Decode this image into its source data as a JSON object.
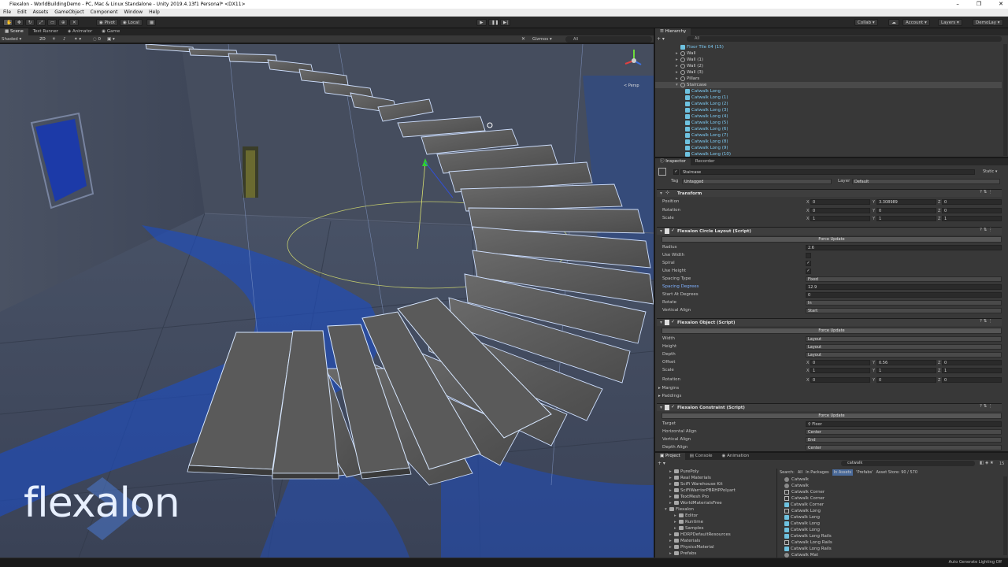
{
  "window": {
    "title": "Flexalon - WorldBuildingDemo - PC, Mac & Linux Standalone - Unity 2019.4.13f1 Personal* <DX11>",
    "controls": [
      "–",
      "❐",
      "✕"
    ]
  },
  "menu": [
    "File",
    "Edit",
    "Assets",
    "GameObject",
    "Component",
    "Window",
    "Help"
  ],
  "toolbar": {
    "pivot": "Pivot",
    "local": "Local",
    "collab": "Collab ▾",
    "account": "Account ▾",
    "layers": "Layers ▾",
    "layout": "DemoLay ▾"
  },
  "scene": {
    "tabs": [
      "Scene",
      "Test Runner",
      "Animator",
      "Game"
    ],
    "shading": "Shaded",
    "gizmos": "Gizmos ▾",
    "search": "All",
    "persp": "< Persp",
    "watermark": "flexalon"
  },
  "hierarchy": {
    "tab": "Hierarchy",
    "search": "All",
    "items": [
      {
        "label": "Floor Tile 04 (15)",
        "indent": 1,
        "kind": "prefab",
        "arrow": ""
      },
      {
        "label": "Wall",
        "indent": 1,
        "kind": "go",
        "arrow": "▸"
      },
      {
        "label": "Wall (1)",
        "indent": 1,
        "kind": "go",
        "arrow": "▸"
      },
      {
        "label": "Wall (2)",
        "indent": 1,
        "kind": "go",
        "arrow": "▸"
      },
      {
        "label": "Wall (3)",
        "indent": 1,
        "kind": "go",
        "arrow": "▸"
      },
      {
        "label": "Pillars",
        "indent": 1,
        "kind": "go",
        "arrow": "▸"
      },
      {
        "label": "Staircase",
        "indent": 1,
        "kind": "go-selected",
        "arrow": "▾"
      },
      {
        "label": "Catwalk Long",
        "indent": 2,
        "kind": "prefab",
        "arrow": ""
      },
      {
        "label": "Catwalk Long (1)",
        "indent": 2,
        "kind": "prefab",
        "arrow": ""
      },
      {
        "label": "Catwalk Long (2)",
        "indent": 2,
        "kind": "prefab",
        "arrow": ""
      },
      {
        "label": "Catwalk Long (3)",
        "indent": 2,
        "kind": "prefab",
        "arrow": ""
      },
      {
        "label": "Catwalk Long (4)",
        "indent": 2,
        "kind": "prefab",
        "arrow": ""
      },
      {
        "label": "Catwalk Long (5)",
        "indent": 2,
        "kind": "prefab",
        "arrow": ""
      },
      {
        "label": "Catwalk Long (6)",
        "indent": 2,
        "kind": "prefab",
        "arrow": ""
      },
      {
        "label": "Catwalk Long (7)",
        "indent": 2,
        "kind": "prefab",
        "arrow": ""
      },
      {
        "label": "Catwalk Long (8)",
        "indent": 2,
        "kind": "prefab",
        "arrow": ""
      },
      {
        "label": "Catwalk Long (9)",
        "indent": 2,
        "kind": "prefab",
        "arrow": ""
      },
      {
        "label": "Catwalk Long (10)",
        "indent": 2,
        "kind": "prefab",
        "arrow": ""
      }
    ]
  },
  "inspector": {
    "tabs": [
      "Inspector",
      "Recorder"
    ],
    "object_name": "Staircase",
    "static": "Static ▾",
    "tag_label": "Tag",
    "tag_value": "Untagged",
    "layer_label": "Layer",
    "layer_value": "Default",
    "transform": {
      "title": "Transform",
      "position": {
        "label": "Position",
        "x": "0",
        "y": "3.308989",
        "z": "0"
      },
      "rotation": {
        "label": "Rotation",
        "x": "0",
        "y": "0",
        "z": "0"
      },
      "scale": {
        "label": "Scale",
        "x": "1",
        "y": "1",
        "z": "1"
      }
    },
    "circle_layout": {
      "title": "Flexalon Circle Layout (Script)",
      "button": "Force Update",
      "radius": {
        "label": "Radius",
        "value": "2.6"
      },
      "use_width": {
        "label": "Use Width",
        "value": ""
      },
      "spiral": {
        "label": "Spiral",
        "value": "✓"
      },
      "use_height": {
        "label": "Use Height",
        "value": "✓"
      },
      "spacing_type": {
        "label": "Spacing Type",
        "value": "Fixed"
      },
      "spacing_degrees": {
        "label": "Spacing Degrees",
        "value": "12.9"
      },
      "start_at_degrees": {
        "label": "Start At Degrees",
        "value": "0"
      },
      "rotate": {
        "label": "Rotate",
        "value": "In"
      },
      "vertical_align": {
        "label": "Vertical Align",
        "value": "Start"
      }
    },
    "object": {
      "title": "Flexalon Object (Script)",
      "button": "Force Update",
      "width": {
        "label": "Width",
        "value": "Layout"
      },
      "height": {
        "label": "Height",
        "value": "Layout"
      },
      "depth": {
        "label": "Depth",
        "value": "Layout"
      },
      "offset": {
        "label": "Offset",
        "x": "0",
        "y": "0.56",
        "z": "0"
      },
      "scale": {
        "label": "Scale",
        "x": "1",
        "y": "1",
        "z": "1"
      },
      "rotation": {
        "label": "Rotation",
        "x": "0",
        "y": "0",
        "z": "0"
      },
      "margins": "Margins",
      "paddings": "Paddings"
    },
    "constraint": {
      "title": "Flexalon Constraint (Script)",
      "button": "Force Update",
      "target": {
        "label": "Target",
        "value": "Floor"
      },
      "horizontal_align": {
        "label": "Horizontal Align",
        "value": "Center"
      },
      "vertical_align": {
        "label": "Vertical Align",
        "value": "End"
      },
      "depth_align": {
        "label": "Depth Align",
        "value": "Center"
      }
    }
  },
  "project": {
    "tabs": [
      "Project",
      "Console",
      "Animation"
    ],
    "search": "catwalk",
    "search_label": "Search:",
    "filters": [
      "All",
      "In Packages",
      "In Assets",
      "'Prefabs'",
      "Asset Store: 90 / 570"
    ],
    "count": "15",
    "folders": [
      {
        "label": "PurePoly",
        "indent": 2
      },
      {
        "label": "Real Materials",
        "indent": 2
      },
      {
        "label": "SciFi Warehouse Kit",
        "indent": 2
      },
      {
        "label": "SciFiWarriorPBRHPPolyart",
        "indent": 2
      },
      {
        "label": "TextMesh Pro",
        "indent": 2
      },
      {
        "label": "WorldMaterialsFree",
        "indent": 2
      },
      {
        "label": "Flexalon",
        "indent": 1
      },
      {
        "label": "Editor",
        "indent": 3
      },
      {
        "label": "Runtime",
        "indent": 3
      },
      {
        "label": "Samples",
        "indent": 3
      },
      {
        "label": "HDRPDefaultResources",
        "indent": 2
      },
      {
        "label": "Materials",
        "indent": 2
      },
      {
        "label": "PhysicsMaterial",
        "indent": 2
      },
      {
        "label": "Prefabs",
        "indent": 2
      }
    ],
    "results": [
      {
        "label": "Catwalk",
        "kind": "mat"
      },
      {
        "label": "Catwalk",
        "kind": "mat"
      },
      {
        "label": "Catwalk Corner",
        "kind": "mesh"
      },
      {
        "label": "Catwalk Corner",
        "kind": "mesh"
      },
      {
        "label": "Catwalk Corner",
        "kind": "prefab"
      },
      {
        "label": "Catwalk Long",
        "kind": "mesh"
      },
      {
        "label": "Catwalk Long",
        "kind": "prefab"
      },
      {
        "label": "Catwalk Long",
        "kind": "prefab"
      },
      {
        "label": "Catwalk Long",
        "kind": "prefab"
      },
      {
        "label": "Catwalk Long Rails",
        "kind": "prefab"
      },
      {
        "label": "Catwalk Long Rails",
        "kind": "mesh"
      },
      {
        "label": "Catwalk Long Rails",
        "kind": "prefab"
      },
      {
        "label": "Catwalk Mat",
        "kind": "mat"
      }
    ]
  },
  "status": {
    "right": "Auto Generate Lighting Off"
  }
}
